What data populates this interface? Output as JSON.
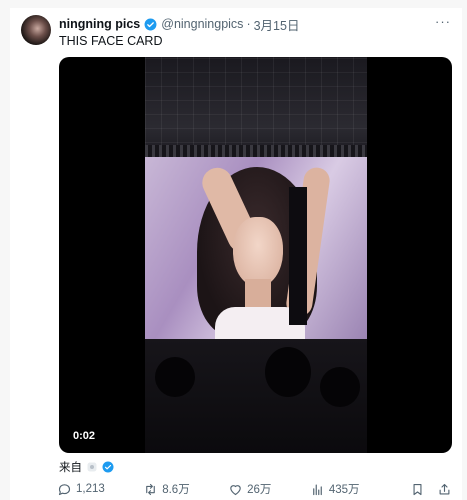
{
  "tweet": {
    "author": {
      "display_name": "ningning pics",
      "handle": "@ningningpics",
      "separator": "·",
      "date": "3月15日"
    },
    "text": "THIS FACE CARD",
    "media": {
      "timestamp": "0:02"
    },
    "source_label": "来自",
    "stats": {
      "replies": "1,213",
      "retweets": "8.6万",
      "likes": "26万",
      "views": "435万"
    },
    "colors": {
      "verified_blue": "#1d9bf0",
      "muted_text": "#536471"
    }
  }
}
